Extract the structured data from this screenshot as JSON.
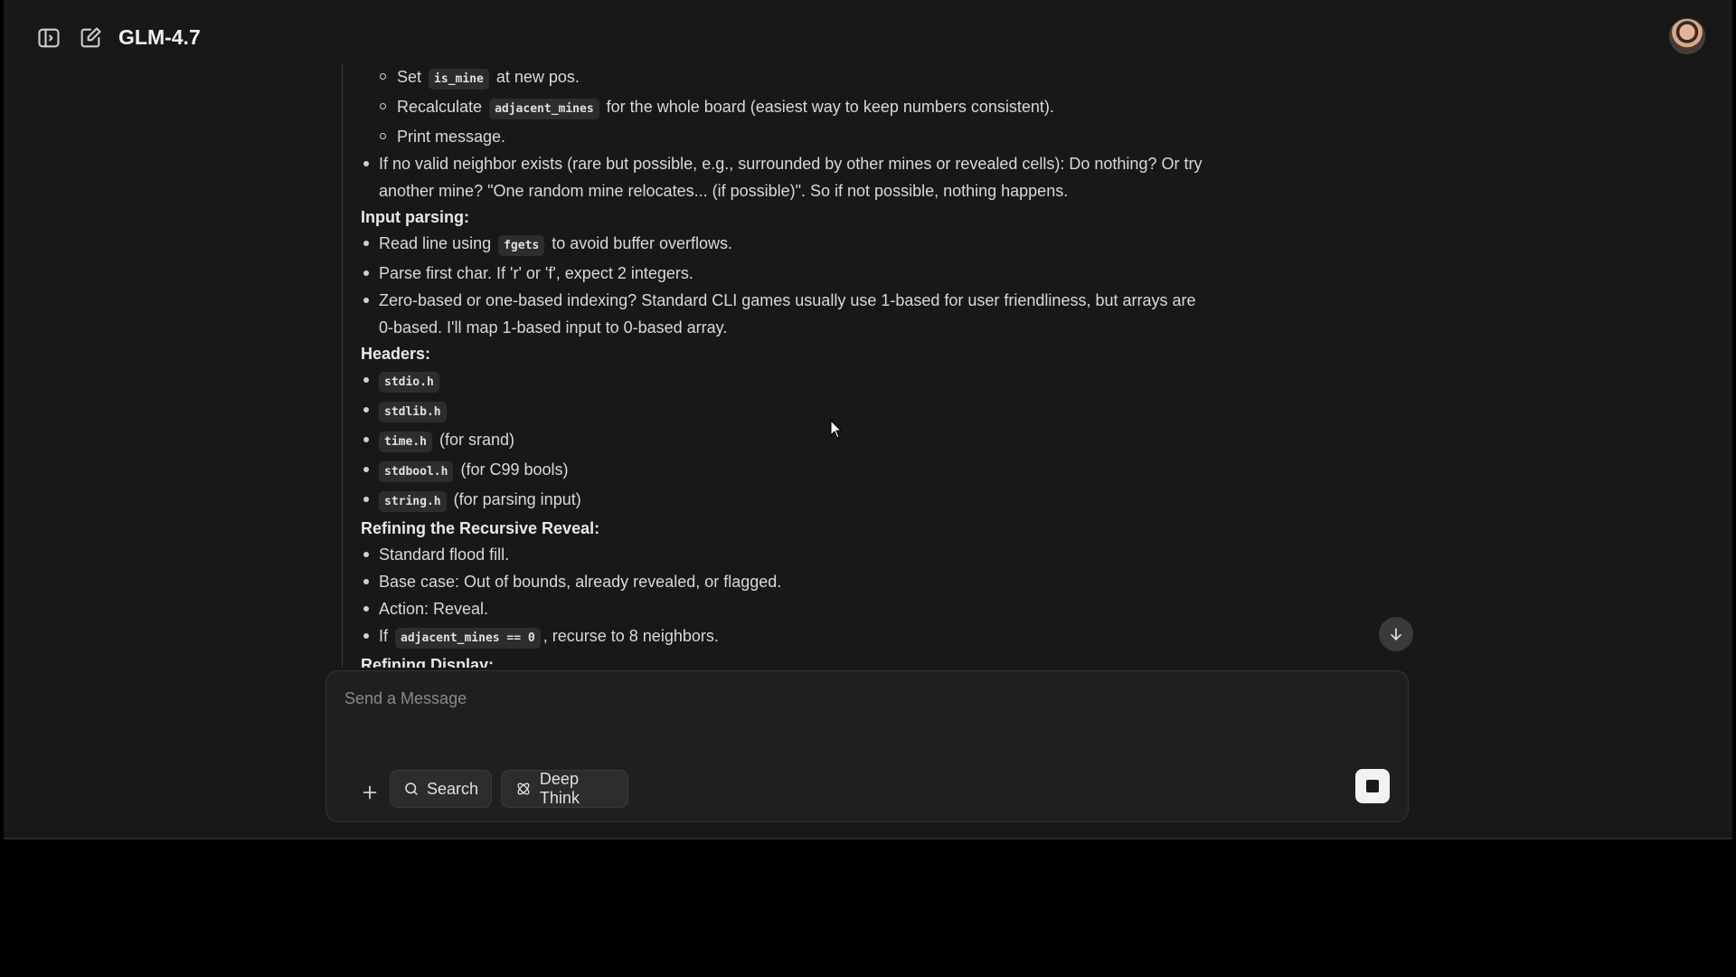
{
  "header": {
    "model_name": "GLM-4.7",
    "icons": {
      "sidebar_toggle": "sidebar-toggle-icon",
      "new_chat": "edit-icon"
    }
  },
  "content": {
    "sub_items": [
      {
        "pre": "Set",
        "code": "is_mine",
        "post": "at new pos."
      },
      {
        "pre": "Recalculate",
        "code": "adjacent_mines",
        "post": "for the whole board (easiest way to keep numbers consistent)."
      },
      {
        "text": "Print message."
      }
    ],
    "no_neighbor": "If no valid neighbor exists (rare but possible, e.g., surrounded by other mines or revealed cells): Do nothing? Or try another mine? \"One random mine relocates... (if possible)\". So if not possible, nothing happens.",
    "input_parsing": {
      "heading": "Input parsing:",
      "item1_pre": "Read line using",
      "item1_code": "fgets",
      "item1_post": "to avoid buffer overflows.",
      "item2": "Parse first char. If 'r' or 'f', expect 2 integers.",
      "item3": "Zero-based or one-based indexing? Standard CLI games usually use 1-based for user friendliness, but arrays are 0-based. I'll map 1-based input to 0-based array."
    },
    "headers": {
      "heading": "Headers:",
      "items": [
        {
          "code": "stdio.h",
          "note": ""
        },
        {
          "code": "stdlib.h",
          "note": ""
        },
        {
          "code": "time.h",
          "note": "(for srand)"
        },
        {
          "code": "stdbool.h",
          "note": "(for C99 bools)"
        },
        {
          "code": "string.h",
          "note": "(for parsing input)"
        }
      ]
    },
    "recursive": {
      "heading": "Refining the Recursive Reveal:",
      "item1": "Standard flood fill.",
      "item2": "Base case: Out of bounds, already revealed, or flagged.",
      "item3": "Action: Reveal.",
      "item4_pre": "If",
      "item4_code": "adjacent_mines == 0",
      "item4_post": ", recurse to 8 neighbors."
    },
    "display_heading": "Refining Display:"
  },
  "composer": {
    "placeholder": "Send a Message",
    "search_label": "Search",
    "deep_think_label": "Deep Think"
  }
}
